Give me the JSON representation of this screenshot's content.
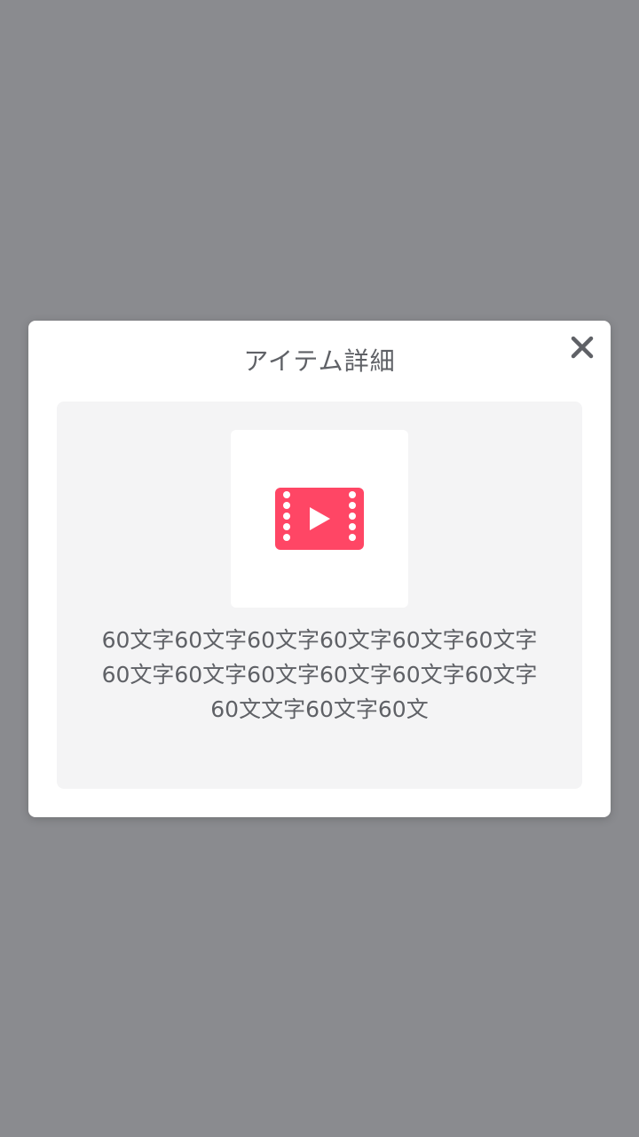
{
  "modal": {
    "title": "アイテム詳細",
    "close_icon": "close-icon"
  },
  "item": {
    "media_icon": "video-film-icon",
    "media_icon_color": "#ff4665",
    "description_lines": [
      "60文字60文字60文字60文字60文字60文字",
      "60文字60文字60文字60文字60文字60文字",
      "60文文字60文字60文"
    ]
  },
  "colors": {
    "overlay": "#8a8b8f",
    "text": "#5f6166",
    "panel": "#f4f4f5"
  }
}
